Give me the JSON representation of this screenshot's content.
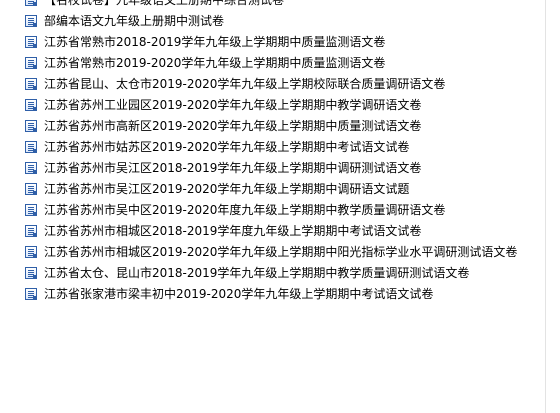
{
  "file_list": {
    "items": [
      {
        "name": "【名校试卷】九年级语文上册期中综合测试卷"
      },
      {
        "name": "部编本语文九年级上册期中测试卷"
      },
      {
        "name": "江苏省常熟市2018-2019学年九年级上学期期中质量监测语文卷"
      },
      {
        "name": "江苏省常熟市2019-2020学年九年级上学期期中质量监测语文卷"
      },
      {
        "name": "江苏省昆山、太仓市2019-2020学年九年级上学期校际联合质量调研语文卷"
      },
      {
        "name": "江苏省苏州工业园区2019-2020学年九年级上学期期中教学调研语文卷"
      },
      {
        "name": "江苏省苏州市高新区2019-2020学年九年级上学期期中质量测试语文卷"
      },
      {
        "name": "江苏省苏州市姑苏区2019-2020学年九年级上学期期中考试语文试卷"
      },
      {
        "name": "江苏省苏州市吴江区2018-2019学年九年级上学期期中调研测试语文卷"
      },
      {
        "name": "江苏省苏州市吴江区2019-2020学年九年级上学期期中调研语文试题"
      },
      {
        "name": "江苏省苏州市吴中区2019-2020年度九年级上学期期中教学质量调研语文卷"
      },
      {
        "name": "江苏省苏州市相城区2018-2019学年度九年级上学期期中考试语文试卷"
      },
      {
        "name": "江苏省苏州市相城区2019-2020学年九年级上学期期中阳光指标学业水平调研测试语文卷"
      },
      {
        "name": "江苏省太仓、昆山市2018-2019学年九年级上学期期中教学质量调研测试语文卷"
      },
      {
        "name": "江苏省张家港市梁丰初中2019-2020学年九年级上学期期中考试语文试卷"
      }
    ],
    "icon": "word-document-icon"
  }
}
